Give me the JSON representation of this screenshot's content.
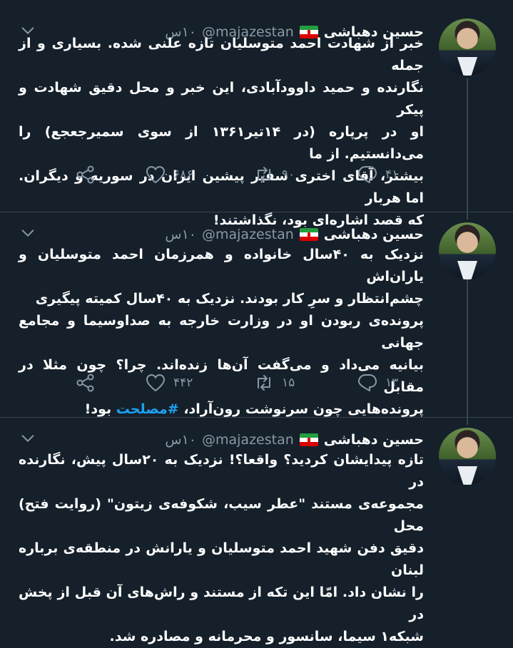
{
  "tweets": [
    {
      "name": "حسین دهباشی",
      "handle": "@majazestan",
      "time": "۱۰س",
      "lines": [
        "خبر از شهادت احمد متوسلیان تازه علنی شده. بسیاری و از جمله",
        "نگارنده و حمید داوودآبادی، این خبر و محل دقیق شهادت و پیکر",
        "او در پرپاره (در ۱۴تیر۱۳۶۱ از سوی سمیرجعجع) را می‌دانستیم. از ما",
        "بیشتر، آقای اختری سفیر پیشین ایران در سوریه و دیگران. اما هربار",
        "که قصد اشاره‌ای بود، نگذاشتند!"
      ],
      "replies": "۴۱",
      "retweets": "۹۰",
      "likes": "۶۸۶"
    },
    {
      "name": "حسین دهباشی",
      "handle": "@majazestan",
      "time": "۱۰س",
      "lines": [
        "نزدیک به ۴۰سال خانواده و همرزمان احمد متوسلیان و یاران‌اش",
        "چشم‌انتظار و سرِ کار بودند. نزدیک به ۴۰سال کمیته پیگیری",
        "پرونده‌ی ربودن او در وزارت خارجه به صداوسیما و مجامع جهانی",
        "بیانیه می‌داد و می‌گفت آن‌ها زنده‌اند. چرا؟ چون مثلا در مقابل"
      ],
      "last_line_before": "پرونده‌هایی چون سرنوشت رون‌آراد، ",
      "hashtag": "#مصلحت",
      "last_line_after": " بود!",
      "replies": "۱۳",
      "retweets": "۱۵",
      "likes": "۴۴۲"
    },
    {
      "name": "حسین دهباشی",
      "handle": "@majazestan",
      "time": "۱۰س",
      "lines": [
        "تازه پیدایشان کردید؟ واقعا؟! نزدیک به ۲۰سال پیش، نگارنده در",
        "مجموعه‌ی مستند \"عطر سیب، شکوفه‌ی زیتون\" (روایت فتح) محل",
        "دقیق دفن شهید احمد متوسلیان و یارانش در منطقه‌ی برباره لبنان",
        "را نشان داد. امّا این تکه از مستند و راش‌های آن قبل از پخش در",
        "شبکه۱ سیما، سانسور و محرمانه و مصادره شد."
      ]
    }
  ],
  "icons": [
    "chevron-down-icon",
    "reply-icon",
    "retweet-icon",
    "like-icon",
    "share-icon"
  ],
  "colors": {
    "background": "#15202b",
    "muted": "#8899a6",
    "link": "#1da1f2",
    "divider": "#38444d"
  }
}
